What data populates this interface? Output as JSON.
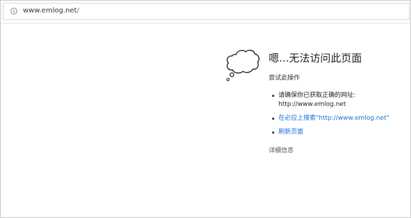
{
  "address_bar": {
    "url_host": "www.emlog.net",
    "url_path": "/",
    "info_icon": "info-circle-icon"
  },
  "error_page": {
    "icon": "thought-cloud-icon",
    "title": "嗯...无法访问此页面",
    "subtitle": "尝试此操作",
    "suggestions": [
      {
        "line1": "请确保你已获取正确的网址:",
        "line2": "http://www.emlog.net"
      },
      {
        "link": "在必应上搜索\"http://www.emlog.net\""
      },
      {
        "link": "刷新页面"
      }
    ],
    "details_label": "详细信息",
    "link_color": "#1a6ed8"
  }
}
